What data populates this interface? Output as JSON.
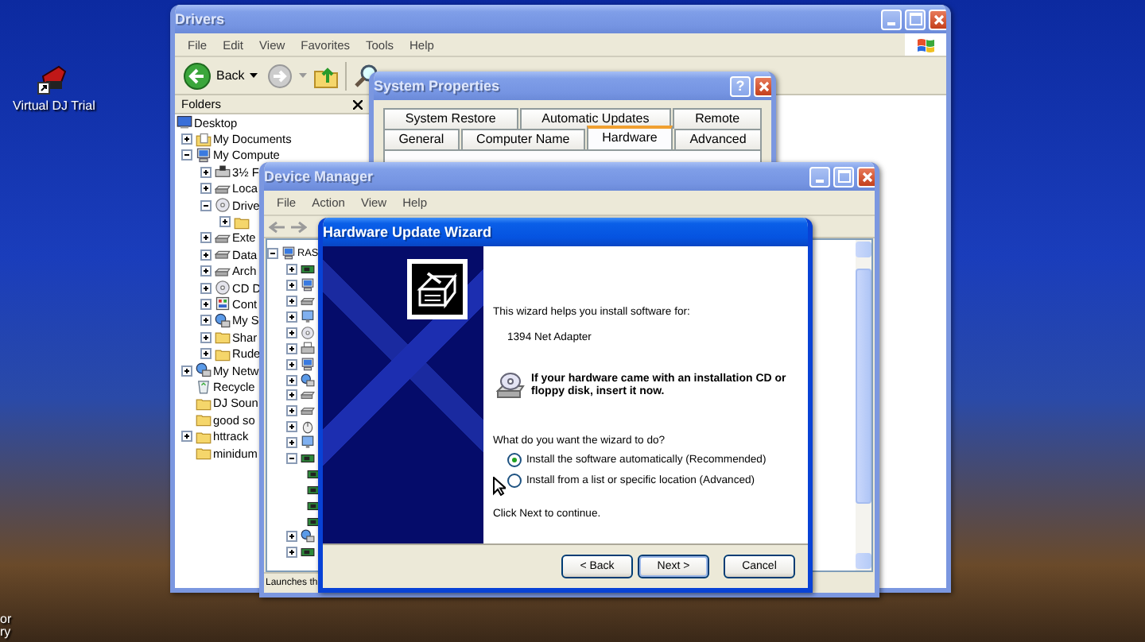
{
  "desktop": {
    "icons": [
      {
        "label": "Virtual DJ Trial",
        "kind": "app"
      },
      {
        "label": "or",
        "kind": "cut"
      },
      {
        "label": "ry",
        "kind": "cut"
      }
    ]
  },
  "explorer": {
    "title": "Drivers",
    "active": false,
    "menu": [
      "File",
      "Edit",
      "View",
      "Favorites",
      "Tools",
      "Help"
    ],
    "back_label": "Back",
    "folders_title": "Folders",
    "tree": [
      {
        "label": "Desktop",
        "kind": "desktop",
        "children": [
          {
            "label": "My Documents",
            "kind": "documents",
            "has_children": true,
            "expanded": false
          },
          {
            "label": "My Compute",
            "kind": "computer",
            "has_children": true,
            "expanded": true,
            "children": [
              {
                "label": "3½ F",
                "kind": "floppy",
                "has_children": true,
                "expanded": false
              },
              {
                "label": "Loca",
                "kind": "drive",
                "has_children": true,
                "expanded": false
              },
              {
                "label": "Drive",
                "kind": "cd",
                "has_children": true,
                "expanded": true,
                "children": [
                  {
                    "kind": "folder",
                    "has_children": true,
                    "expanded": false
                  }
                ]
              },
              {
                "label": "Exte",
                "kind": "drive",
                "has_children": true,
                "expanded": false
              },
              {
                "label": "Data",
                "kind": "drive",
                "has_children": true,
                "expanded": false
              },
              {
                "label": "Arch",
                "kind": "drive",
                "has_children": true,
                "expanded": false
              },
              {
                "label": "CD D",
                "kind": "cd",
                "has_children": true,
                "expanded": false
              },
              {
                "label": "Cont",
                "kind": "control",
                "has_children": true,
                "expanded": false
              },
              {
                "label": "My S",
                "kind": "network",
                "has_children": true,
                "expanded": false
              },
              {
                "label": "Shar",
                "kind": "folder",
                "has_children": true,
                "expanded": false
              },
              {
                "label": "Rude",
                "kind": "folder",
                "has_children": true,
                "expanded": false
              }
            ]
          },
          {
            "label": "My Netw",
            "kind": "network",
            "has_children": true,
            "expanded": false
          },
          {
            "label": "Recycle",
            "kind": "recycle",
            "has_children": false
          },
          {
            "label": "DJ Soun",
            "kind": "folder",
            "has_children": false
          },
          {
            "label": "good so",
            "kind": "folder",
            "has_children": false
          },
          {
            "label": "httrack",
            "kind": "folder",
            "has_children": true,
            "expanded": false
          },
          {
            "label": "minidum",
            "kind": "folder",
            "has_children": false
          }
        ]
      }
    ]
  },
  "system_properties": {
    "title": "System Properties",
    "active": false,
    "help": "?",
    "tab_rows": [
      {
        "tabs": [
          {
            "label": "System Restore",
            "selected": false
          },
          {
            "label": "Automatic Updates",
            "selected": false
          },
          {
            "label": "Remote",
            "selected": false
          }
        ]
      },
      {
        "tabs": [
          {
            "label": "General",
            "selected": false
          },
          {
            "label": "Computer Name",
            "selected": false
          },
          {
            "label": "Hardware",
            "selected": true
          },
          {
            "label": "Advanced",
            "selected": false
          }
        ]
      }
    ]
  },
  "device_manager": {
    "title": "Device Manager",
    "active": false,
    "menu": [
      "File",
      "Action",
      "View",
      "Help"
    ],
    "status": "Launches th",
    "tree": [
      {
        "label": "RAS",
        "kind": "computer",
        "has_children": true,
        "expanded": true,
        "children": [
          {
            "kind": "chip",
            "has_children": true,
            "expanded": false
          },
          {
            "kind": "computer",
            "has_children": true,
            "expanded": false
          },
          {
            "kind": "drive",
            "has_children": true,
            "expanded": false
          },
          {
            "kind": "monitor",
            "has_children": true,
            "expanded": false
          },
          {
            "kind": "cd",
            "has_children": true,
            "expanded": false
          },
          {
            "kind": "printer",
            "has_children": true,
            "expanded": false
          },
          {
            "kind": "computer",
            "has_children": true,
            "expanded": false
          },
          {
            "kind": "network",
            "has_children": true,
            "expanded": false
          },
          {
            "kind": "drive",
            "has_children": true,
            "expanded": false
          },
          {
            "kind": "drive",
            "has_children": true,
            "expanded": false
          },
          {
            "kind": "mouse",
            "has_children": true,
            "expanded": false
          },
          {
            "kind": "monitor",
            "has_children": true,
            "expanded": false
          },
          {
            "kind": "chip",
            "has_children": true,
            "expanded": true,
            "children": [
              {
                "kind": "chip",
                "has_children": false
              },
              {
                "kind": "chip",
                "has_children": false
              },
              {
                "kind": "chip",
                "has_children": false
              },
              {
                "kind": "chip",
                "has_children": false
              }
            ]
          },
          {
            "kind": "network",
            "has_children": true,
            "expanded": false
          },
          {
            "kind": "chip",
            "has_children": true,
            "expanded": false
          }
        ]
      }
    ]
  },
  "wizard": {
    "title": "Hardware Update Wizard",
    "active": true,
    "intro": "This wizard helps you install software for:",
    "device": "1394 Net Adapter",
    "notice": "If your hardware came with an installation CD or floppy disk, insert it now.",
    "question": "What do you want the wizard to do?",
    "options": [
      {
        "label": "Install the software automatically (Recommended)",
        "selected": true
      },
      {
        "label": "Install from a list or specific location (Advanced)",
        "selected": false
      }
    ],
    "footer": "Click Next to continue.",
    "buttons": [
      {
        "label": "< Back",
        "kind": "normal"
      },
      {
        "label": "Next >",
        "kind": "default"
      },
      {
        "label": "Cancel",
        "kind": "cancel"
      }
    ]
  }
}
